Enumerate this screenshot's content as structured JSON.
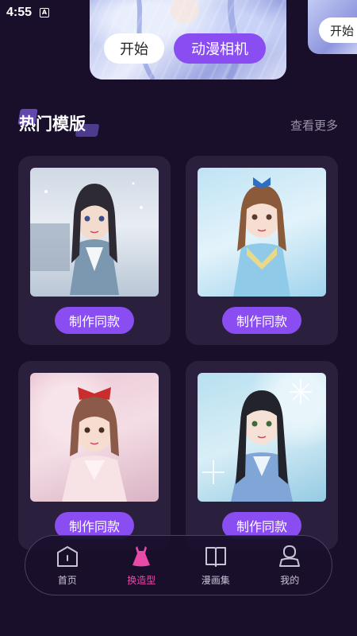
{
  "status": {
    "time": "4:55",
    "notification_glyph": "A"
  },
  "banner": {
    "start_label": "开始",
    "camera_label": "动漫相机"
  },
  "banner_peek": {
    "start_label": "开始"
  },
  "section": {
    "title": "热门模版",
    "more_label": "查看更多"
  },
  "cards": [
    {
      "button_label": "制作同款",
      "image_icon": "anime-girl-hanfu-winter"
    },
    {
      "button_label": "制作同款",
      "image_icon": "anime-girl-blue-dress"
    },
    {
      "button_label": "制作同款",
      "image_icon": "anime-girl-red-bow"
    },
    {
      "button_label": "制作同款",
      "image_icon": "anime-girl-snowflake"
    }
  ],
  "nav": {
    "items": [
      {
        "label": "首页",
        "icon": "home-icon"
      },
      {
        "label": "换造型",
        "icon": "dress-icon"
      },
      {
        "label": "漫画集",
        "icon": "book-icon"
      },
      {
        "label": "我的",
        "icon": "user-icon"
      }
    ],
    "active_index": 1
  },
  "colors": {
    "background": "#1a0f2b",
    "card": "#2a1f3d",
    "accent_purple": "#8a4df2",
    "active_pink": "#e84aa8"
  }
}
